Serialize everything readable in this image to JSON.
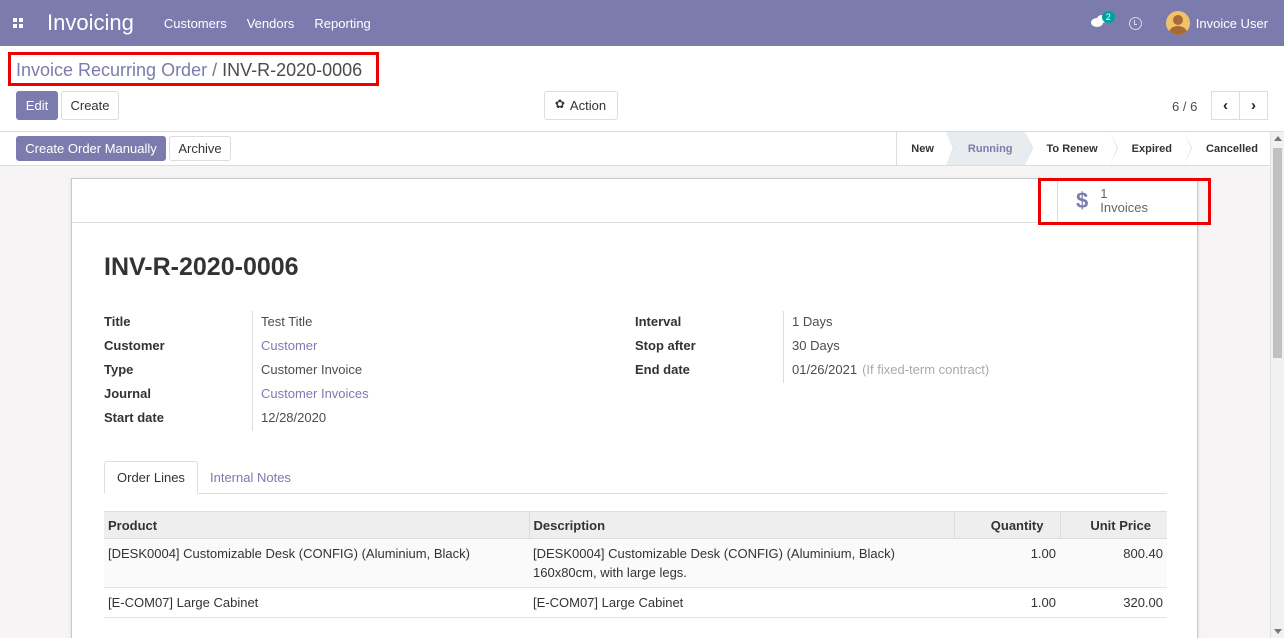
{
  "navbar": {
    "app_name": "Invoicing",
    "menu": [
      "Customers",
      "Vendors",
      "Reporting"
    ],
    "chat_count": "2",
    "user_name": "Invoice User"
  },
  "breadcrumb": {
    "parent": "Invoice Recurring Order",
    "separator": "/",
    "current": "INV-R-2020-0006"
  },
  "toolbar": {
    "edit_label": "Edit",
    "create_label": "Create",
    "action_label": "Action"
  },
  "pager": {
    "value": "6 / 6",
    "prev_icon": "chevron-left-icon",
    "next_icon": "chevron-right-icon"
  },
  "header_buttons": {
    "create_order_label": "Create Order Manually",
    "archive_label": "Archive"
  },
  "stages": [
    {
      "label": "New",
      "active": false
    },
    {
      "label": "Running",
      "active": true
    },
    {
      "label": "To Renew",
      "active": false
    },
    {
      "label": "Expired",
      "active": false
    },
    {
      "label": "Cancelled",
      "active": false
    }
  ],
  "stat_button": {
    "icon": "$",
    "value": "1",
    "label": "Invoices"
  },
  "record": {
    "title": "INV-R-2020-0006",
    "left_fields": [
      {
        "label": "Title",
        "value": "Test Title",
        "link": false
      },
      {
        "label": "Customer",
        "value": "Customer",
        "link": true
      },
      {
        "label": "Type",
        "value": "Customer Invoice",
        "link": false
      },
      {
        "label": "Journal",
        "value": "Customer Invoices",
        "link": true
      },
      {
        "label": "Start date",
        "value": "12/28/2020",
        "link": false
      }
    ],
    "right_fields": [
      {
        "label": "Interval",
        "value": "1 Days",
        "note": ""
      },
      {
        "label": "Stop after",
        "value": "30 Days",
        "note": ""
      },
      {
        "label": "End date",
        "value": "01/26/2021",
        "note": "(If fixed-term contract)"
      }
    ]
  },
  "tabs": [
    "Order Lines",
    "Internal Notes"
  ],
  "lines": {
    "columns": [
      "Product",
      "Description",
      "Quantity",
      "Unit Price"
    ],
    "rows": [
      {
        "product": "[DESK0004] Customizable Desk (CONFIG) (Aluminium, Black)",
        "description_1": "[DESK0004] Customizable Desk (CONFIG) (Aluminium, Black)",
        "description_2": "160x80cm, with large legs.",
        "quantity": "1.00",
        "unit_price": "800.40"
      },
      {
        "product": "[E-COM07] Large Cabinet",
        "description_1": "[E-COM07] Large Cabinet",
        "description_2": "",
        "quantity": "1.00",
        "unit_price": "320.00"
      }
    ]
  },
  "colors": {
    "brand": "#7c7bad",
    "highlight": "#ee0000"
  }
}
